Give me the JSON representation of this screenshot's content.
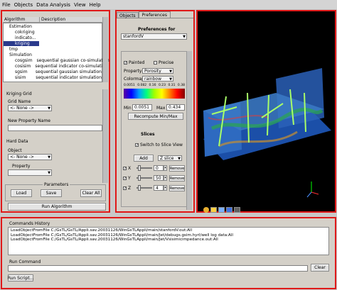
{
  "menu": [
    "File",
    "Objects",
    "Data Analysis",
    "View",
    "Help"
  ],
  "algo_tree": {
    "headers": [
      "Algorithm",
      "Description"
    ],
    "rows": [
      {
        "indent": 1,
        "label": "Estimation",
        "desc": ""
      },
      {
        "indent": 2,
        "label": "cokriging",
        "desc": ""
      },
      {
        "indent": 2,
        "label": "indicato...",
        "desc": ""
      },
      {
        "indent": 2,
        "label": "kriging",
        "desc": "",
        "selected": true
      },
      {
        "indent": 1,
        "label": "tmp",
        "desc": ""
      },
      {
        "indent": 1,
        "label": "Simulation",
        "desc": ""
      },
      {
        "indent": 2,
        "label": "cosgsim",
        "desc": "sequential gaussian co-simulation"
      },
      {
        "indent": 2,
        "label": "cosisim",
        "desc": "sequential indicator co-simulation"
      },
      {
        "indent": 2,
        "label": "sgsim",
        "desc": "sequential gaussian simulation"
      },
      {
        "indent": 2,
        "label": "sisim",
        "desc": "sequential indicator simulation"
      }
    ]
  },
  "kriging": {
    "section": "Kriging Grid",
    "grid_name_label": "Grid Name",
    "grid_name_value": "<- None ->",
    "new_prop_label": "New Property Name",
    "new_prop_value": "",
    "hard_data": "Hard Data",
    "object_label": "Object",
    "object_value": "<- None ->",
    "property_label": "Property",
    "property_value": ""
  },
  "parameters": {
    "title": "Parameters",
    "load": "Load",
    "save": "Save",
    "clear": "Clear All",
    "run": "Run Algorithm"
  },
  "tabs": [
    "Objects",
    "Preferences"
  ],
  "prefs": {
    "title": "Preferences for",
    "object": "stanfordV",
    "painted": "Painted",
    "precise": "Precise",
    "property_label": "Property",
    "property_value": "Porosity",
    "colormap_label": "Colormap",
    "colormap_value": "rainbow",
    "ticks": [
      "0.0051",
      "0.082",
      "0.16",
      "0.23",
      "0.31",
      "0.38"
    ],
    "min_label": "Min",
    "min_value": "0.0051",
    "max_label": "Max",
    "max_value": "0.434",
    "recompute": "Recompute Min/Max",
    "slices_title": "Slices",
    "switch_slice": "Switch to Slice View",
    "add_label": "Add",
    "add_axis": "Z slice",
    "slices": [
      {
        "axis": "X",
        "value": "0",
        "remove": "Remove"
      },
      {
        "axis": "Y",
        "value": "50",
        "remove": "Remove"
      },
      {
        "axis": "Z",
        "value": "4",
        "remove": "Remove"
      }
    ]
  },
  "commands": {
    "title": "Commands History",
    "history": [
      "LoadObjectFromFile  C:/GsTL/GsTL/Appli.sav.20031126/WinGsTLAppli/main/stanfordV.out:All",
      "LoadObjectFromFile  C:/GsTL/GsTL/Appli.sav.20031126/WinGsTLAppli/main/Jet/debugs.gsim.hyrl/well log data:All",
      "LoadObjectFromFile  C:/GsTL/GsTL/Appli.sav.20031126/WinGsTLAppli/main/Jet/Vsisimicimpedance.out:All"
    ],
    "run_label": "Run Command",
    "run_value": "",
    "clear": "Clear",
    "run_script": "Run Script..."
  },
  "colors": {
    "frame": "#e01818",
    "panel": "#d4d0c8",
    "select_bg": "#2a3a8c",
    "viewer_bg": "#000000"
  }
}
